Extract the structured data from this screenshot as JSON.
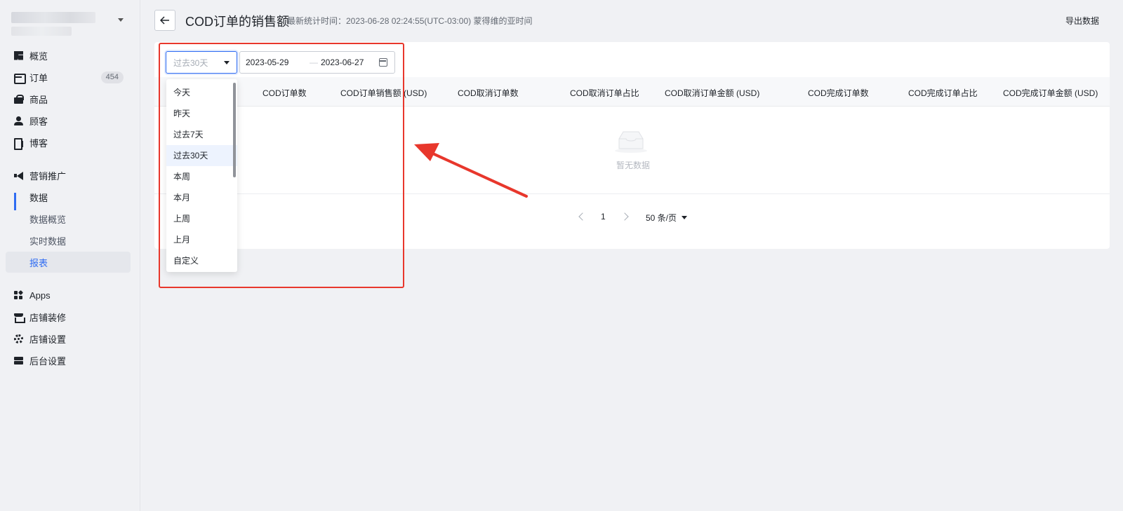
{
  "sidebar": {
    "items": [
      {
        "label": "概览",
        "icon": "overview-icon"
      },
      {
        "label": "订单",
        "icon": "inbox-icon",
        "badge": "454"
      },
      {
        "label": "商品",
        "icon": "bag-icon"
      },
      {
        "label": "顾客",
        "icon": "user-icon"
      },
      {
        "label": "博客",
        "icon": "blog-icon"
      },
      {
        "label": "营销推广",
        "icon": "megaphone-icon"
      },
      {
        "label": "数据",
        "icon": "bar-chart-icon"
      },
      {
        "label": "数据概览"
      },
      {
        "label": "实时数据"
      },
      {
        "label": "报表"
      },
      {
        "label": "Apps",
        "icon": "apps-icon"
      },
      {
        "label": "店铺装修",
        "icon": "store-icon"
      },
      {
        "label": "店铺设置",
        "icon": "gear-icon"
      },
      {
        "label": "后台设置",
        "icon": "server-icon"
      }
    ]
  },
  "header": {
    "title": "COD订单的销售额",
    "subtitle": "最新统计时间：2023-06-28 02:24:55(UTC-03:00) 蒙得维的亚时间",
    "export_label": "导出数据"
  },
  "filters": {
    "range_placeholder": "过去30天",
    "date_start": "2023-05-29",
    "date_sep": "—",
    "date_end": "2023-06-27"
  },
  "dropdown": {
    "options": [
      "今天",
      "昨天",
      "过去7天",
      "过去30天",
      "本周",
      "本月",
      "上周",
      "上月",
      "自定义"
    ],
    "selected": "过去30天"
  },
  "table": {
    "columns": [
      "COD订单数",
      "COD订单销售额 (USD)",
      "COD取消订单数",
      "COD取消订单占比",
      "COD取消订单金额 (USD)",
      "COD完成订单数",
      "COD完成订单占比",
      "COD完成订单金额 (USD)"
    ],
    "empty_text": "暂无数据"
  },
  "pagination": {
    "current_page": "1",
    "page_size": "50 条/页"
  },
  "colors": {
    "accent": "#2f6cf2",
    "annotation": "#e8372c"
  }
}
